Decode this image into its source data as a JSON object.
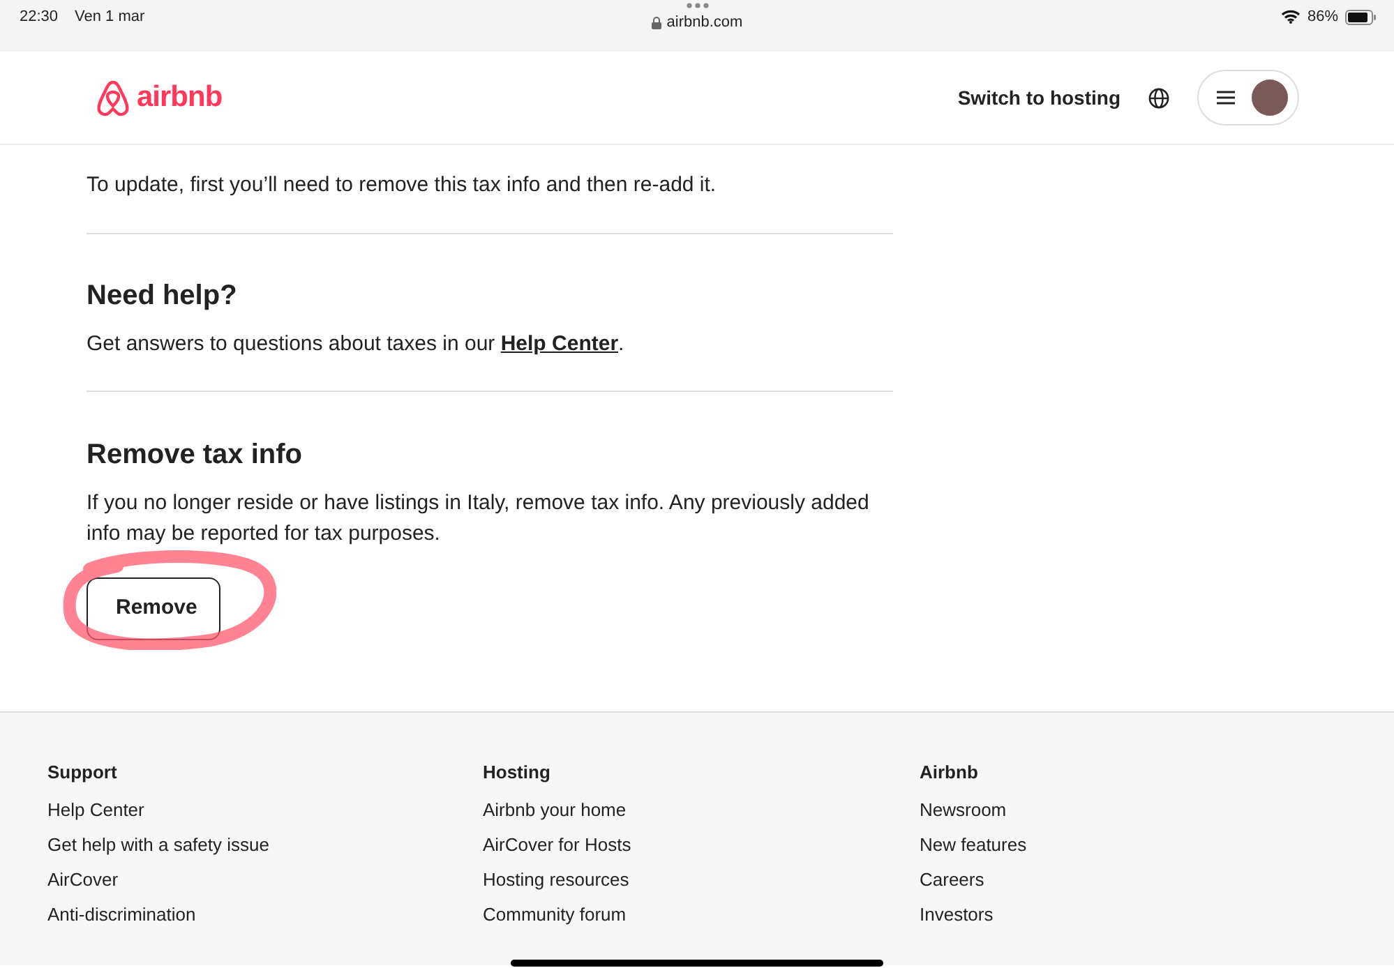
{
  "status_bar": {
    "time": "22:30",
    "date": "Ven 1 mar",
    "url": "airbnb.com",
    "battery": "86%"
  },
  "header": {
    "logo": "airbnb",
    "switch_link": "Switch to hosting"
  },
  "intro": "To update, first you’ll need to remove this tax info and then re-add it.",
  "help": {
    "title": "Need help?",
    "text": "Get answers to questions about taxes in our ",
    "link": "Help Center",
    "after": "."
  },
  "remove": {
    "title": "Remove tax info",
    "text": "If you no longer reside or have listings in Italy, remove tax info. Any previously added info may be reported for tax purposes.",
    "button": "Remove",
    "circled": true
  },
  "footer": [
    {
      "heading": "Support",
      "links": [
        "Help Center",
        "Get help with a safety issue",
        "AirCover",
        "Anti-discrimination"
      ]
    },
    {
      "heading": "Hosting",
      "links": [
        "Airbnb your home",
        "AirCover for Hosts",
        "Hosting resources",
        "Community forum"
      ]
    },
    {
      "heading": "Airbnb",
      "links": [
        "Newsroom",
        "New features",
        "Careers",
        "Investors"
      ]
    }
  ]
}
